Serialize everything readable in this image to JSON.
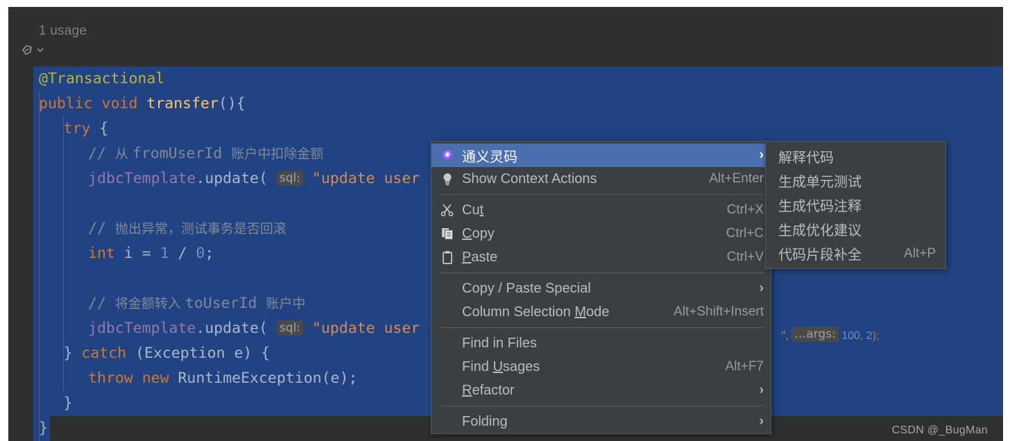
{
  "editor": {
    "usage_hint": "1 usage",
    "lines": [
      {
        "indent": 0,
        "tokens": [
          {
            "t": "@Transactional",
            "c": "ann"
          }
        ]
      },
      {
        "indent": 0,
        "tokens": [
          {
            "t": "public",
            "c": "k"
          },
          {
            "t": " ",
            "c": "pun"
          },
          {
            "t": "void",
            "c": "k"
          },
          {
            "t": " ",
            "c": "pun"
          },
          {
            "t": "transfer",
            "c": "fn"
          },
          {
            "t": "(){",
            "c": "pun"
          }
        ]
      },
      {
        "indent": 1,
        "tokens": [
          {
            "t": "try",
            "c": "k"
          },
          {
            "t": " {",
            "c": "pun"
          }
        ]
      },
      {
        "indent": 2,
        "tokens": [
          {
            "t": "// ",
            "c": "cmt"
          },
          {
            "t": "从 ",
            "c": "cmt cn"
          },
          {
            "t": "fromUserId ",
            "c": "cmt"
          },
          {
            "t": "账户中扣除金额",
            "c": "cmt cn"
          }
        ]
      },
      {
        "indent": 2,
        "tokens": [
          {
            "t": "jdbcTemplate",
            "c": "fld"
          },
          {
            "t": ".",
            "c": "pun"
          },
          {
            "t": "update",
            "c": "id"
          },
          {
            "t": "( ",
            "c": "pun"
          },
          {
            "t": "sql:",
            "c": "hint"
          },
          {
            "t": " ",
            "c": "pun"
          },
          {
            "t": "\"update user s",
            "c": "str"
          }
        ]
      },
      {
        "indent": 0,
        "tokens": []
      },
      {
        "indent": 2,
        "tokens": [
          {
            "t": "// ",
            "c": "cmt"
          },
          {
            "t": "抛出异常，测试事务是否回滚",
            "c": "cmt cn"
          }
        ]
      },
      {
        "indent": 2,
        "tokens": [
          {
            "t": "int",
            "c": "k"
          },
          {
            "t": " ",
            "c": "pun"
          },
          {
            "t": "i",
            "c": "id"
          },
          {
            "t": " = ",
            "c": "pun"
          },
          {
            "t": "1",
            "c": "num"
          },
          {
            "t": " / ",
            "c": "pun"
          },
          {
            "t": "0",
            "c": "num"
          },
          {
            "t": ";",
            "c": "pun"
          }
        ]
      },
      {
        "indent": 0,
        "tokens": []
      },
      {
        "indent": 2,
        "tokens": [
          {
            "t": "// ",
            "c": "cmt"
          },
          {
            "t": "将金额转入 ",
            "c": "cmt cn"
          },
          {
            "t": "toUserId ",
            "c": "cmt"
          },
          {
            "t": "账户中",
            "c": "cmt cn"
          }
        ]
      },
      {
        "indent": 2,
        "tokens": [
          {
            "t": "jdbcTemplate",
            "c": "fld"
          },
          {
            "t": ".",
            "c": "pun"
          },
          {
            "t": "update",
            "c": "id"
          },
          {
            "t": "( ",
            "c": "pun"
          },
          {
            "t": "sql:",
            "c": "hint"
          },
          {
            "t": " ",
            "c": "pun"
          },
          {
            "t": "\"update user s",
            "c": "str"
          }
        ]
      },
      {
        "indent": 1,
        "tokens": [
          {
            "t": "} ",
            "c": "pun"
          },
          {
            "t": "catch",
            "c": "k"
          },
          {
            "t": " (Exception e) {",
            "c": "pun"
          }
        ]
      },
      {
        "indent": 2,
        "tokens": [
          {
            "t": "throw",
            "c": "k"
          },
          {
            "t": " ",
            "c": "pun"
          },
          {
            "t": "new",
            "c": "k"
          },
          {
            "t": " RuntimeException(e);",
            "c": "pun"
          }
        ]
      },
      {
        "indent": 1,
        "tokens": [
          {
            "t": "}",
            "c": "pun"
          }
        ]
      },
      {
        "indent": 0,
        "tokens": [
          {
            "t": "}",
            "c": "pun"
          }
        ]
      }
    ],
    "tail_fragment": {
      "quote": "\",",
      "hint": "…args:",
      "arg1": "100",
      "comma": ",",
      "arg2": "2",
      "close": ");"
    }
  },
  "context_menu": {
    "items": [
      {
        "label": "通义灵码",
        "icon": "tongyi-lingma-icon",
        "accel": "",
        "arrow": "›",
        "selected": true,
        "cjk": true
      },
      {
        "label": "Show Context Actions",
        "icon": "lightbulb-icon",
        "accel": "Alt+Enter",
        "arrow": "",
        "selected": false,
        "cjk": false
      },
      {
        "separator": true
      },
      {
        "label": "Cut",
        "mnemonic": "t",
        "icon": "scissors-icon",
        "accel": "Ctrl+X",
        "arrow": "",
        "selected": false,
        "cjk": false
      },
      {
        "label": "Copy",
        "mnemonic": "C",
        "icon": "copy-icon",
        "accel": "Ctrl+C",
        "arrow": "",
        "selected": false,
        "cjk": false
      },
      {
        "label": "Paste",
        "mnemonic": "P",
        "icon": "clipboard-icon",
        "accel": "Ctrl+V",
        "arrow": "",
        "selected": false,
        "cjk": false
      },
      {
        "separator": true
      },
      {
        "label": "Copy / Paste Special",
        "icon": "",
        "accel": "",
        "arrow": "›",
        "selected": false,
        "cjk": false
      },
      {
        "label": "Column Selection Mode",
        "mnemonic": "M",
        "icon": "",
        "accel": "Alt+Shift+Insert",
        "arrow": "",
        "selected": false,
        "cjk": false
      },
      {
        "separator": true
      },
      {
        "label": "Find in Files",
        "icon": "",
        "accel": "",
        "arrow": "",
        "selected": false,
        "cjk": false
      },
      {
        "label": "Find Usages",
        "mnemonic": "U",
        "icon": "",
        "accel": "Alt+F7",
        "arrow": "",
        "selected": false,
        "cjk": false
      },
      {
        "label": "Refactor",
        "mnemonic": "R",
        "icon": "",
        "accel": "",
        "arrow": "›",
        "selected": false,
        "cjk": false
      },
      {
        "separator": true
      },
      {
        "label": "Folding",
        "icon": "",
        "accel": "",
        "arrow": "›",
        "selected": false,
        "cjk": false
      }
    ]
  },
  "submenu": {
    "items": [
      {
        "label": "解释代码",
        "accel": ""
      },
      {
        "label": "生成单元测试",
        "accel": ""
      },
      {
        "label": "生成代码注释",
        "accel": ""
      },
      {
        "label": "生成优化建议",
        "accel": ""
      },
      {
        "label": "代码片段补全",
        "accel": "Alt+P"
      }
    ]
  },
  "watermark": "CSDN @_BugMan",
  "colors": {
    "editor_bg": "#2f2f2f",
    "selection_bg": "#214283",
    "menu_bg": "#3c3f41",
    "menu_selected_bg": "#4b6eaf",
    "keyword": "#cc7832",
    "annotation": "#bbb529",
    "string": "#d98b4a",
    "number": "#6897bb",
    "comment": "#7f8a95",
    "field": "#9876aa",
    "method": "#ffc66d",
    "plain": "#a9b7c6"
  }
}
